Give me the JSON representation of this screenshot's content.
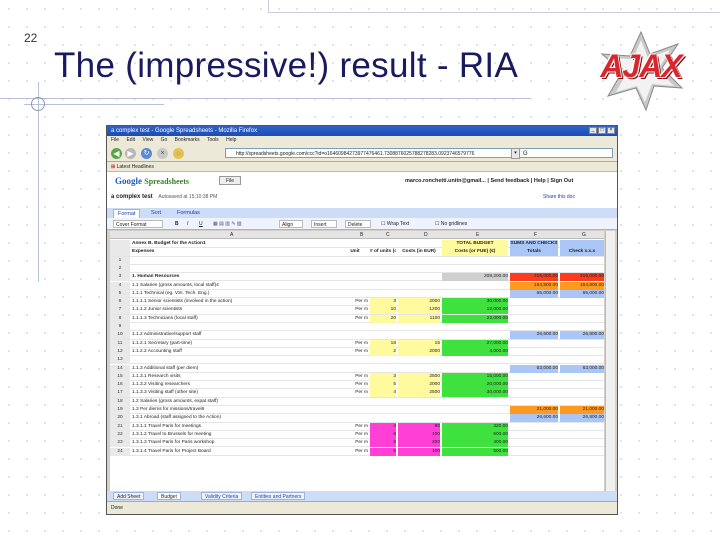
{
  "slide": {
    "number": "22",
    "title": "The (impressive!) result - RIA",
    "logo_text": "AJAX"
  },
  "browser": {
    "title": "a complex test - Google Spreadsheets - Mozilla Firefox",
    "menu": [
      "File",
      "Edit",
      "View",
      "Go",
      "Bookmarks",
      "Tools",
      "Help"
    ],
    "url": "http://spreadsheets.google.com/ccc?id=o16460984273977476461.7308876025788278283.0923746579776",
    "search_value": "G",
    "bookmark_label": "Latest Headlines"
  },
  "gsheet": {
    "logo_google": "Google",
    "logo_product": "Spreadsheets",
    "file_button": "File",
    "doc_name": "a complex test",
    "autosave": "Autosaved at 15:10:38 PM",
    "user": "marco.ronchetti.unitn@gmail... | Send feedback | Help | Sign Out",
    "share_link": "Share this doc",
    "tabs": [
      "Format",
      "Sort",
      "Formulas"
    ],
    "toolbar": [
      "Cover Format",
      "B",
      "I",
      "U",
      "Align",
      "Insert",
      "Delete",
      "Wrap Text",
      "No gridlines"
    ],
    "columns": [
      "A",
      "B",
      "C",
      "D",
      "E",
      "F",
      "G"
    ],
    "rows": [
      {
        "n": "",
        "a": "Annex B. Budget for the Action1",
        "b": "",
        "c": "",
        "d": "",
        "e": "TOTAL BUDGET",
        "f": "SUMS AND CHECKS",
        "g": ""
      },
      {
        "n": "",
        "a": "Expenses",
        "b": "Unit",
        "c": "# of units (or FUE)",
        "d": "Costs (in EUR)",
        "e": "Costs (or FUE) (€)",
        "f": "Totals",
        "g": "Check x.x.x"
      },
      {
        "n": "1",
        "a": "",
        "b": "",
        "c": "",
        "d": "",
        "e": "",
        "f": "",
        "g": ""
      },
      {
        "n": "2",
        "a": "",
        "b": "",
        "c": "",
        "d": "",
        "e": "",
        "f": "",
        "g": ""
      },
      {
        "n": "3",
        "a": "1. Human Resources",
        "b": "",
        "c": "",
        "d": "",
        "e": "208,200.00",
        "f": "216,000.00",
        "g": "216,000.00"
      },
      {
        "n": "4",
        "a": "1.1 Salaries (gross amounts, local staff)4",
        "b": "",
        "c": "",
        "d": "",
        "e": "",
        "f": "154,800.00",
        "g": "154,800.00"
      },
      {
        "n": "5",
        "a": "1.1.1 Technical (eg. VSI. Tech. Eng.)",
        "b": "",
        "c": "",
        "d": "",
        "e": "",
        "f": "65,000.00",
        "g": "65,000.00"
      },
      {
        "n": "6",
        "a": "1.1.1.1 Senior scientists (involved in the action)",
        "b": "Per m",
        "c": "3",
        "d": "2000",
        "e": "30,000.00",
        "f": "",
        "g": ""
      },
      {
        "n": "7",
        "a": "1.1.1.2 Junior scientists",
        "b": "Per m",
        "c": "10",
        "d": "1200",
        "e": "12,000.00",
        "f": "",
        "g": ""
      },
      {
        "n": "8",
        "a": "1.1.1.3 Technicians (local staff)",
        "b": "Per m",
        "c": "20",
        "d": "1100",
        "e": "22,000.00",
        "f": "",
        "g": ""
      },
      {
        "n": "9",
        "a": "",
        "b": "",
        "c": "",
        "d": "",
        "e": "",
        "f": "",
        "g": ""
      },
      {
        "n": "10",
        "a": "1.1.2 Administrative/support staff",
        "b": "",
        "c": "",
        "d": "",
        "e": "",
        "f": "26,600.00",
        "g": "26,800.00"
      },
      {
        "n": "11",
        "a": "1.1.2.1 Secretary (part-time)",
        "b": "Per m",
        "c": "18",
        "d": "15",
        "e": "27,000.00",
        "f": "",
        "g": ""
      },
      {
        "n": "12",
        "a": "1.1.2.2 Accounting staff",
        "b": "Per m",
        "c": "2",
        "d": "2000",
        "e": "4,000.00",
        "f": "",
        "g": ""
      },
      {
        "n": "13",
        "a": "",
        "b": "",
        "c": "",
        "d": "",
        "e": "",
        "f": "",
        "g": ""
      },
      {
        "n": "14",
        "a": "1.1.3 Additional staff (per diem)",
        "b": "",
        "c": "",
        "d": "",
        "e": "",
        "f": "63,000.00",
        "g": "63,000.00"
      },
      {
        "n": "15",
        "a": "1.1.3.1 Research visits",
        "b": "Per m",
        "c": "3",
        "d": "2500",
        "e": "15,000.00",
        "f": "",
        "g": ""
      },
      {
        "n": "16",
        "a": "1.1.3.2 Visiting researchers",
        "b": "Per m",
        "c": "5",
        "d": "2000",
        "e": "20,000.00",
        "f": "",
        "g": ""
      },
      {
        "n": "17",
        "a": "1.1.3.3 Visiting staff (other site)",
        "b": "Per m",
        "c": "4",
        "d": "2500",
        "e": "30,000.00",
        "f": "",
        "g": ""
      },
      {
        "n": "18",
        "a": "1.2 Salaries (gross amounts, expat staff)",
        "b": "",
        "c": "",
        "d": "",
        "e": "",
        "f": "",
        "g": ""
      },
      {
        "n": "19",
        "a": "1.3 Per diems for missions/travel6",
        "b": "",
        "c": "",
        "d": "",
        "e": "",
        "f": "21,000.00",
        "g": "21,000.00"
      },
      {
        "n": "20",
        "a": "1.3.1 Abroad (staff assigned to the Action)",
        "b": "",
        "c": "",
        "d": "",
        "e": "",
        "f": "26,600.00",
        "g": "26,800.00"
      },
      {
        "n": "21",
        "a": "1.3.1.1 Travel Paris for meetings",
        "b": "Per m",
        "c": "4",
        "d": "80",
        "e": "320.00",
        "f": "",
        "g": ""
      },
      {
        "n": "22",
        "a": "1.3.1.2 Travel to Brussels for meeting",
        "b": "Per m",
        "c": "6",
        "d": "100",
        "e": "600.00",
        "f": "",
        "g": ""
      },
      {
        "n": "23",
        "a": "1.3.1.3 Travel Paris for Paris workshop",
        "b": "Per m",
        "c": "2",
        "d": "200",
        "e": "400.00",
        "f": "",
        "g": ""
      },
      {
        "n": "24",
        "a": "1.3.1.4 Travel Paris for Project Board",
        "b": "Per m",
        "c": "5",
        "d": "100",
        "e": "500.00",
        "f": "",
        "g": ""
      }
    ],
    "sheet_tabs": [
      "Add Sheet",
      "Budget",
      "Validity Criteria",
      "Entities and Partners"
    ],
    "status": "Done"
  },
  "colors": {
    "green": "#3fe13f",
    "yellow": "#fffa9e",
    "magenta": "#ff3fd6",
    "blue": "#a9c6f6",
    "red": "#ff3b1f",
    "orange": "#ff9a1f",
    "grey": "#cfcfcf"
  }
}
